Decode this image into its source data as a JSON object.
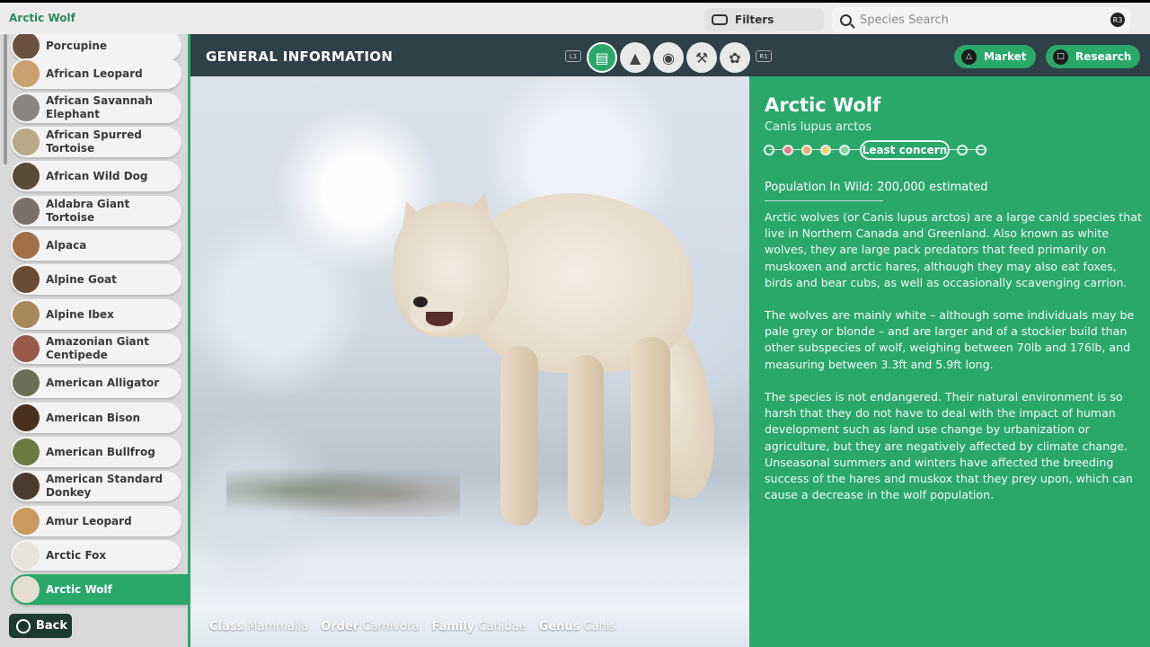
{
  "app": {
    "title": "Arctic Wolf"
  },
  "filters": {
    "label": "Filters"
  },
  "search": {
    "placeholder": "Species Search",
    "button_hint": "R3"
  },
  "sidebar": {
    "items": [
      {
        "label": "Porcupine",
        "icon": "porcupine-avatar"
      },
      {
        "label": "African Leopard",
        "icon": "leopard-avatar"
      },
      {
        "label": "African Savannah Elephant",
        "icon": "elephant-avatar"
      },
      {
        "label": "African Spurred Tortoise",
        "icon": "tortoise-avatar"
      },
      {
        "label": "African Wild Dog",
        "icon": "wild-dog-avatar"
      },
      {
        "label": "Aldabra Giant Tortoise",
        "icon": "tortoise-avatar"
      },
      {
        "label": "Alpaca",
        "icon": "alpaca-avatar"
      },
      {
        "label": "Alpine Goat",
        "icon": "goat-avatar"
      },
      {
        "label": "Alpine Ibex",
        "icon": "ibex-avatar"
      },
      {
        "label": "Amazonian Giant Centipede",
        "icon": "centipede-avatar"
      },
      {
        "label": "American Alligator",
        "icon": "alligator-avatar"
      },
      {
        "label": "American Bison",
        "icon": "bison-avatar"
      },
      {
        "label": "American Bullfrog",
        "icon": "bullfrog-avatar"
      },
      {
        "label": "American Standard Donkey",
        "icon": "donkey-avatar"
      },
      {
        "label": "Amur Leopard",
        "icon": "leopard-avatar"
      },
      {
        "label": "Arctic Fox",
        "icon": "fox-avatar"
      },
      {
        "label": "Arctic Wolf",
        "icon": "wolf-avatar",
        "active": true
      }
    ],
    "back_label": "Back"
  },
  "header": {
    "title": "GENERAL INFORMATION",
    "left_shoulder": "L1",
    "right_shoulder": "R1",
    "tabs": [
      "clipboard-icon",
      "habitat-icon",
      "diet-icon",
      "enrichment-icon",
      "paw-icon"
    ],
    "market_label": "Market",
    "research_label": "Research"
  },
  "taxonomy": {
    "class_label": "Class",
    "class_value": "Mammalia",
    "order_label": "Order",
    "order_value": "Carnivora",
    "family_label": "Family",
    "family_value": "Canidae",
    "genus_label": "Genus",
    "genus_value": "Canis"
  },
  "info": {
    "name": "Arctic Wolf",
    "latin": "Canis lupus arctos",
    "status": "Least concern",
    "status_dot_colors": [
      "#e8f6ee",
      "#e87a8a",
      "#f0a878",
      "#f0d070",
      "#7fd49a"
    ],
    "population": "Population In Wild: 200,000 estimated",
    "paragraphs": [
      "Arctic wolves (or Canis lupus arctos) are a large canid species that live in Northern Canada and Greenland. Also known as white wolves, they are large pack predators that feed primarily on muskoxen and arctic hares, although they may also eat foxes, birds and bear cubs, as well as occasionally scavenging carrion.",
      "The wolves are mainly white – although some individuals may be pale grey or blonde – and are larger and of a stockier build than other subspecies of wolf, weighing between 70lb and 176lb, and measuring between 3.3ft and 5.9ft long.",
      "The species is not endangered. Their natural environment is so harsh that they do not have to deal with the impact of human development such as land use change by urbanization or agriculture, but they are negatively affected by climate change. Unseasonal summers and winters have affected the breeding success of the hares and muskox that they prey upon, which can cause a decrease in the wolf population."
    ]
  },
  "colors": {
    "accent": "#2aa86a",
    "header": "#2e4048"
  }
}
